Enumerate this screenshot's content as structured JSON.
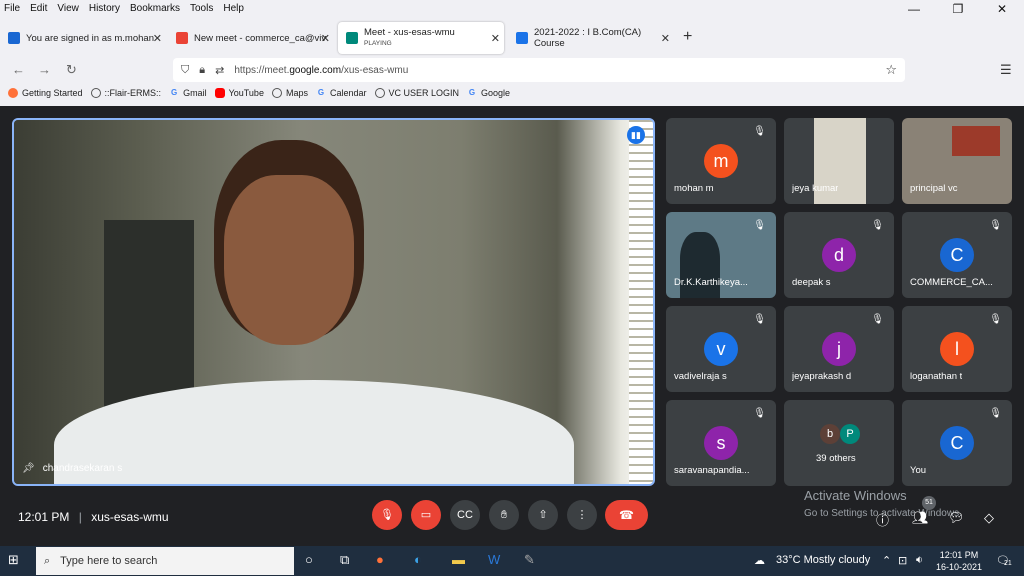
{
  "menu": {
    "file": "File",
    "edit": "Edit",
    "view": "View",
    "history": "History",
    "bookmarks": "Bookmarks",
    "tools": "Tools",
    "help": "Help"
  },
  "window_controls": {
    "minimize": "—",
    "maximize": "❐",
    "close": "✕"
  },
  "tabs": [
    {
      "title": "You are signed in as m.mohan",
      "close": "✕"
    },
    {
      "title": "New meet - commerce_ca@viv",
      "close": "✕"
    },
    {
      "title": "Meet - xus-esas-wmu",
      "subtitle": "PLAYING",
      "close": "✕"
    },
    {
      "title": "2021-2022 : I B.Com(CA) Course",
      "close": "✕"
    }
  ],
  "new_tab": "+",
  "nav": {
    "back": "←",
    "forward": "→",
    "reload": "↻"
  },
  "url": {
    "prefix": "https://meet.",
    "host": "google.com",
    "path": "/xus-esas-wmu"
  },
  "bookmarks": [
    "Getting Started",
    "::Flair-ERMS::",
    "Gmail",
    "YouTube",
    "Maps",
    "Calendar",
    "VC USER LOGIN",
    "Google"
  ],
  "main": {
    "speaker": "chandrasekaran s"
  },
  "participants": [
    {
      "name": "mohan m",
      "initial": "m",
      "color": "#f4511e"
    },
    {
      "name": "jeya kumar",
      "photo": true
    },
    {
      "name": "principal vc",
      "photo": true
    },
    {
      "name": "Dr.K.Karthikeya...",
      "photo": true
    },
    {
      "name": "deepak s",
      "initial": "d",
      "color": "#8e24aa"
    },
    {
      "name": "COMMERCE_CA...",
      "initial": "C",
      "color": "#1967d2"
    },
    {
      "name": "vadivelraja s",
      "initial": "v",
      "color": "#1a73e8"
    },
    {
      "name": "jeyaprakash d",
      "initial": "j",
      "color": "#8e24aa"
    },
    {
      "name": "loganathan t",
      "initial": "l",
      "color": "#f4511e"
    },
    {
      "name": "saravanapandia...",
      "initial": "s",
      "color": "#8e24aa"
    },
    {
      "name": "39 others",
      "initials": [
        "b",
        "P"
      ]
    },
    {
      "name": "You",
      "initial": "C",
      "color": "#1967d2"
    }
  ],
  "bottom": {
    "time": "12:01 PM",
    "separator": "|",
    "meeting_code": "xus-esas-wmu",
    "people_count": "51"
  },
  "watermark": {
    "line1": "Activate Windows",
    "line2": "Go to Settings to activate Windows."
  },
  "taskbar": {
    "search_placeholder": "Type here to search",
    "weather": "33°C  Mostly cloudy",
    "time": "12:01 PM",
    "date": "16-10-2021",
    "notif_count": "21"
  }
}
